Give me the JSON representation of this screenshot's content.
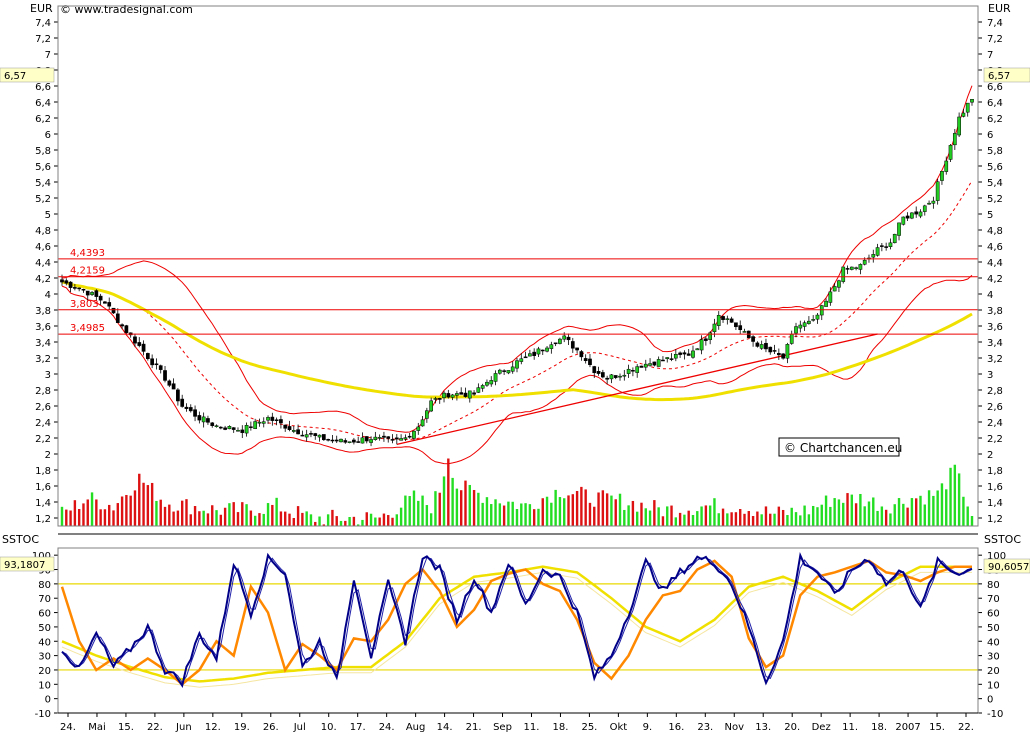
{
  "chart_data": [
    {
      "type": "candlestick",
      "currency_label": "EUR",
      "watermark_top": "© www.tradesignal.com",
      "watermark_box": "© Chartchancen.eu",
      "ylim": [
        1.1,
        7.6
      ],
      "y_ticks": [
        "1,2",
        "1,4",
        "1,6",
        "1,8",
        "2",
        "2,2",
        "2,4",
        "2,6",
        "2,8",
        "3",
        "3,2",
        "3,4",
        "3,6",
        "3,8",
        "4",
        "4,2",
        "4,4",
        "4,6",
        "4,8",
        "5",
        "5,2",
        "5,4",
        "5,6",
        "5,8",
        "6",
        "6,2",
        "6,4",
        "6,6",
        "6,8",
        "7",
        "7,2",
        "7,4"
      ],
      "y_tick_values": [
        1.2,
        1.4,
        1.6,
        1.8,
        2,
        2.2,
        2.4,
        2.6,
        2.8,
        3,
        3.2,
        3.4,
        3.6,
        3.8,
        4,
        4.2,
        4.4,
        4.6,
        4.8,
        5,
        5.2,
        5.4,
        5.6,
        5.8,
        6,
        6.2,
        6.4,
        6.6,
        6.8,
        7,
        7.2,
        7.4
      ],
      "last_price_label": "6,57",
      "last_price": 6.57,
      "horizontal_levels": [
        {
          "label": "4,4393",
          "value": 4.4393
        },
        {
          "label": "4,2159",
          "value": 4.2159
        },
        {
          "label": "3,803",
          "value": 3.803
        },
        {
          "label": "3,4985",
          "value": 3.4985
        }
      ],
      "x_labels": [
        "24.",
        "Mai",
        "15.",
        "22.",
        "Jun",
        "12.",
        "19.",
        "26.",
        "Jul",
        "10.",
        "17.",
        "24.",
        "Aug",
        "14.",
        "21.",
        "Sep",
        "11.",
        "18.",
        "25.",
        "Okt",
        "9.",
        "16.",
        "23.",
        "Nov",
        "13.",
        "20.",
        "Dez",
        "11.",
        "18.",
        "2007",
        "15.",
        "22."
      ],
      "price_keypoints": [
        [
          0,
          4.15
        ],
        [
          5,
          4.05
        ],
        [
          10,
          3.9
        ],
        [
          14,
          3.6
        ],
        [
          18,
          3.35
        ],
        [
          24,
          2.95
        ],
        [
          28,
          2.6
        ],
        [
          32,
          2.45
        ],
        [
          36,
          2.35
        ],
        [
          42,
          2.3
        ],
        [
          48,
          2.45
        ],
        [
          54,
          2.3
        ],
        [
          60,
          2.2
        ],
        [
          66,
          2.15
        ],
        [
          72,
          2.2
        ],
        [
          77,
          2.15
        ],
        [
          80,
          2.2
        ],
        [
          83,
          2.35
        ],
        [
          86,
          2.65
        ],
        [
          90,
          2.75
        ],
        [
          96,
          2.75
        ],
        [
          100,
          2.95
        ],
        [
          106,
          3.15
        ],
        [
          110,
          3.25
        ],
        [
          114,
          3.4
        ],
        [
          117,
          3.45
        ],
        [
          121,
          3.25
        ],
        [
          124,
          3.05
        ],
        [
          127,
          2.95
        ],
        [
          130,
          3.0
        ],
        [
          134,
          3.1
        ],
        [
          138,
          3.15
        ],
        [
          142,
          3.2
        ],
        [
          146,
          3.25
        ],
        [
          150,
          3.45
        ],
        [
          153,
          3.75
        ],
        [
          156,
          3.65
        ],
        [
          160,
          3.45
        ],
        [
          164,
          3.3
        ],
        [
          168,
          3.2
        ],
        [
          171,
          3.6
        ],
        [
          175,
          3.65
        ],
        [
          178,
          3.9
        ],
        [
          182,
          4.3
        ],
        [
          186,
          4.35
        ],
        [
          190,
          4.55
        ],
        [
          193,
          4.65
        ],
        [
          196,
          4.95
        ],
        [
          200,
          5.05
        ],
        [
          203,
          5.2
        ],
        [
          206,
          5.7
        ],
        [
          209,
          6.2
        ],
        [
          212,
          6.45
        ]
      ],
      "volume_keypoints": [
        [
          0,
          1.25
        ],
        [
          6,
          1.45
        ],
        [
          12,
          1.35
        ],
        [
          18,
          1.7
        ],
        [
          24,
          1.4
        ],
        [
          30,
          1.35
        ],
        [
          36,
          1.3
        ],
        [
          42,
          1.3
        ],
        [
          50,
          1.35
        ],
        [
          58,
          1.2
        ],
        [
          66,
          1.2
        ],
        [
          74,
          1.2
        ],
        [
          82,
          1.45
        ],
        [
          86,
          1.35
        ],
        [
          88,
          1.55
        ],
        [
          90,
          2.0
        ],
        [
          92,
          1.6
        ],
        [
          100,
          1.45
        ],
        [
          108,
          1.35
        ],
        [
          116,
          1.55
        ],
        [
          124,
          1.45
        ],
        [
          132,
          1.4
        ],
        [
          140,
          1.3
        ],
        [
          150,
          1.35
        ],
        [
          158,
          1.35
        ],
        [
          166,
          1.25
        ],
        [
          174,
          1.3
        ],
        [
          180,
          1.45
        ],
        [
          186,
          1.45
        ],
        [
          192,
          1.35
        ],
        [
          198,
          1.45
        ],
        [
          204,
          1.5
        ],
        [
          208,
          1.8
        ],
        [
          212,
          1.25
        ]
      ]
    },
    {
      "type": "line",
      "indicator_label": "SSTOC",
      "ylim": [
        -10,
        105
      ],
      "y_ticks": [
        "-10",
        "0",
        "10",
        "20",
        "30",
        "40",
        "50",
        "60",
        "70",
        "80",
        "90",
        "100"
      ],
      "y_tick_values": [
        -10,
        0,
        10,
        20,
        30,
        40,
        50,
        60,
        70,
        80,
        90,
        100
      ],
      "reference_levels": [
        20,
        80
      ],
      "left_value_label": "93,1807",
      "left_value": 93.1807,
      "right_value_label": "90,6057",
      "right_value": 90.6057,
      "blue_keypoints": [
        [
          0,
          35
        ],
        [
          4,
          20
        ],
        [
          8,
          45
        ],
        [
          12,
          22
        ],
        [
          16,
          35
        ],
        [
          20,
          50
        ],
        [
          24,
          20
        ],
        [
          28,
          12
        ],
        [
          32,
          45
        ],
        [
          36,
          28
        ],
        [
          40,
          95
        ],
        [
          44,
          60
        ],
        [
          48,
          98
        ],
        [
          52,
          88
        ],
        [
          56,
          22
        ],
        [
          60,
          40
        ],
        [
          64,
          12
        ],
        [
          68,
          85
        ],
        [
          72,
          30
        ],
        [
          76,
          80
        ],
        [
          80,
          40
        ],
        [
          84,
          100
        ],
        [
          88,
          90
        ],
        [
          92,
          55
        ],
        [
          96,
          85
        ],
        [
          100,
          60
        ],
        [
          104,
          95
        ],
        [
          108,
          65
        ],
        [
          112,
          90
        ],
        [
          116,
          85
        ],
        [
          120,
          60
        ],
        [
          124,
          15
        ],
        [
          128,
          30
        ],
        [
          132,
          60
        ],
        [
          136,
          95
        ],
        [
          140,
          75
        ],
        [
          144,
          88
        ],
        [
          148,
          98
        ],
        [
          152,
          95
        ],
        [
          156,
          80
        ],
        [
          160,
          50
        ],
        [
          164,
          12
        ],
        [
          168,
          40
        ],
        [
          172,
          98
        ],
        [
          176,
          88
        ],
        [
          180,
          72
        ],
        [
          184,
          90
        ],
        [
          188,
          98
        ],
        [
          192,
          80
        ],
        [
          196,
          90
        ],
        [
          200,
          62
        ],
        [
          204,
          95
        ],
        [
          208,
          88
        ],
        [
          212,
          90
        ]
      ],
      "orange_keypoints": [
        [
          0,
          78
        ],
        [
          4,
          40
        ],
        [
          8,
          20
        ],
        [
          12,
          28
        ],
        [
          16,
          20
        ],
        [
          20,
          28
        ],
        [
          24,
          20
        ],
        [
          28,
          10
        ],
        [
          32,
          20
        ],
        [
          36,
          40
        ],
        [
          40,
          30
        ],
        [
          44,
          78
        ],
        [
          48,
          60
        ],
        [
          52,
          20
        ],
        [
          56,
          38
        ],
        [
          60,
          30
        ],
        [
          64,
          20
        ],
        [
          68,
          42
        ],
        [
          72,
          40
        ],
        [
          76,
          55
        ],
        [
          80,
          80
        ],
        [
          84,
          90
        ],
        [
          88,
          75
        ],
        [
          92,
          50
        ],
        [
          96,
          62
        ],
        [
          100,
          82
        ],
        [
          104,
          87
        ],
        [
          108,
          90
        ],
        [
          112,
          80
        ],
        [
          116,
          75
        ],
        [
          120,
          55
        ],
        [
          124,
          25
        ],
        [
          128,
          14
        ],
        [
          132,
          30
        ],
        [
          136,
          55
        ],
        [
          140,
          72
        ],
        [
          144,
          75
        ],
        [
          148,
          90
        ],
        [
          152,
          96
        ],
        [
          156,
          85
        ],
        [
          160,
          42
        ],
        [
          164,
          22
        ],
        [
          168,
          30
        ],
        [
          172,
          72
        ],
        [
          176,
          85
        ],
        [
          180,
          88
        ],
        [
          184,
          92
        ],
        [
          188,
          96
        ],
        [
          192,
          88
        ],
        [
          196,
          86
        ],
        [
          200,
          82
        ],
        [
          204,
          88
        ],
        [
          208,
          92
        ],
        [
          212,
          92
        ]
      ],
      "yellow_keypoints": [
        [
          0,
          40
        ],
        [
          8,
          30
        ],
        [
          16,
          22
        ],
        [
          24,
          15
        ],
        [
          32,
          12
        ],
        [
          40,
          14
        ],
        [
          48,
          18
        ],
        [
          56,
          20
        ],
        [
          64,
          22
        ],
        [
          72,
          22
        ],
        [
          80,
          40
        ],
        [
          88,
          70
        ],
        [
          96,
          85
        ],
        [
          104,
          88
        ],
        [
          112,
          92
        ],
        [
          120,
          88
        ],
        [
          128,
          70
        ],
        [
          136,
          50
        ],
        [
          144,
          40
        ],
        [
          152,
          55
        ],
        [
          160,
          78
        ],
        [
          168,
          85
        ],
        [
          176,
          75
        ],
        [
          184,
          62
        ],
        [
          192,
          80
        ],
        [
          200,
          92
        ],
        [
          208,
          92
        ],
        [
          212,
          92
        ]
      ]
    }
  ]
}
